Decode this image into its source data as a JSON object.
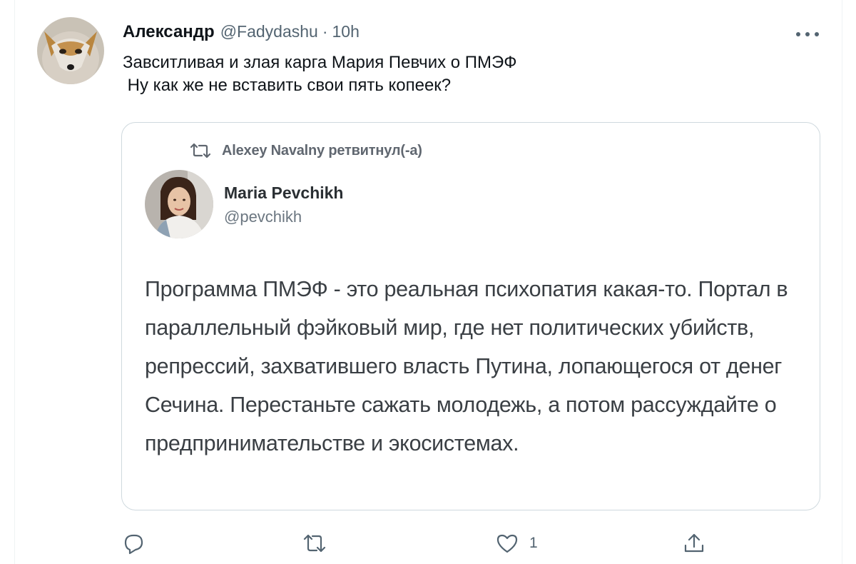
{
  "tweet": {
    "display_name": "Александр",
    "handle": "@Fadydashu",
    "separator": "·",
    "time": "10h",
    "text": "Завситливая и злая карга Мария Певчих о ПМЭФ\n Ну как же не вставить свои пять копеек?"
  },
  "quoted": {
    "retweet_label": "Alexey Navalny ретвитнул(-а)",
    "name": "Maria Pevchikh",
    "handle": "@pevchikh",
    "text": "Программа ПМЭФ - это реальная психопатия какая-то. Портал в параллельный фэйковый мир, где нет политических убийств, репрессий, захватившего власть Путина, лопающегося от денег Сечина. Перестаньте сажать молодежь, а потом рассуждайте о предпринимательстве и экосистемах."
  },
  "actions": {
    "reply_icon": "reply-icon",
    "retweet_icon": "retweet-icon",
    "like_icon": "heart-icon",
    "like_count": "1",
    "share_icon": "share-icon"
  },
  "colors": {
    "text": "#0f1419",
    "secondary": "#536471",
    "border": "#cfd9de"
  }
}
